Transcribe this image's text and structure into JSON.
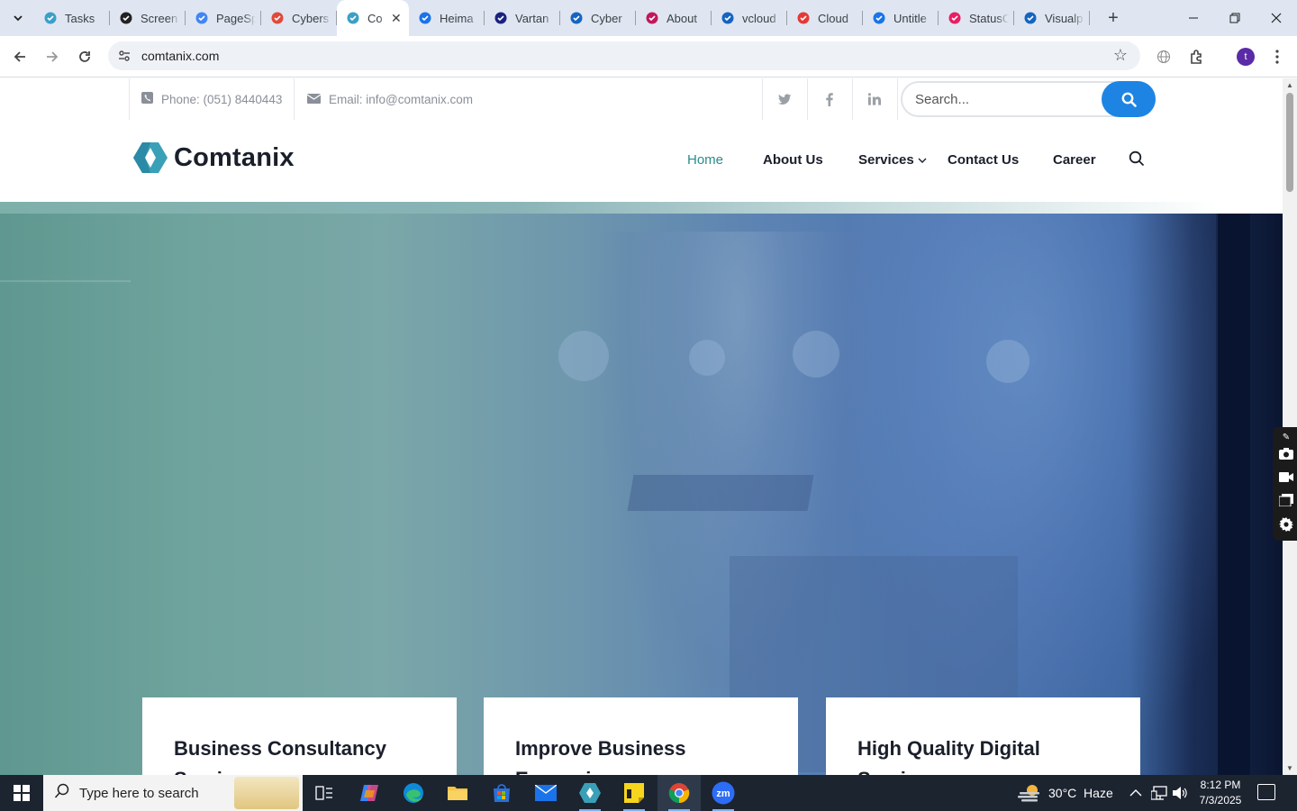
{
  "browser": {
    "tabs": [
      {
        "title": "Tasks",
        "icon": "blue-hex-icon",
        "color": "#3aa0c8"
      },
      {
        "title": "Screen",
        "icon": "camera-shutter-icon",
        "color": "#222222"
      },
      {
        "title": "PageSp",
        "icon": "pagespeed-gauge-icon",
        "color": "#4285f4"
      },
      {
        "title": "Cybers",
        "icon": "red-shield-icon",
        "color": "#e04a3a"
      },
      {
        "title": "Co",
        "icon": "comtanix-logo-icon",
        "color": "#3aa0c8",
        "active": true
      },
      {
        "title": "Heima",
        "icon": "scales-icon",
        "color": "#1a73e8"
      },
      {
        "title": "Vartan",
        "icon": "x-logo-icon",
        "color": "#1a237e"
      },
      {
        "title": "Cyber",
        "icon": "checkmark-logo-icon",
        "color": "#1565c0"
      },
      {
        "title": "About",
        "icon": "red-dot-icon",
        "color": "#c2185b"
      },
      {
        "title": "vcloud",
        "icon": "vcloud-icon",
        "color": "#1565c0"
      },
      {
        "title": "Cloud",
        "icon": "slash-logo-icon",
        "color": "#e53935"
      },
      {
        "title": "Untitle",
        "icon": "docs-icon",
        "color": "#1a73e8"
      },
      {
        "title": "StatusC",
        "icon": "bolt-icon",
        "color": "#e91e63"
      },
      {
        "title": "Visualp",
        "icon": "pulse-icon",
        "color": "#1565c0"
      }
    ],
    "url": "comtanix.com",
    "profile_initial": "t"
  },
  "site": {
    "phone": "Phone: (051) 8440443",
    "email": "Email: info@comtanix.com",
    "search_placeholder": "Search...",
    "logo_text": "Comtanix",
    "nav": [
      "Home",
      "About Us",
      "Services",
      "Contact Us",
      "Career"
    ],
    "cards": [
      "Business Consultancy Services",
      "Improve Business Expansion",
      "High Quality Digital Services"
    ],
    "accent": "#2a8c8c",
    "search_button_color": "#1d84e3"
  },
  "taskbar": {
    "search_placeholder": "Type here to search",
    "weather": "30°C  Haze",
    "time": "8:12 PM",
    "date": "7/3/2025"
  }
}
